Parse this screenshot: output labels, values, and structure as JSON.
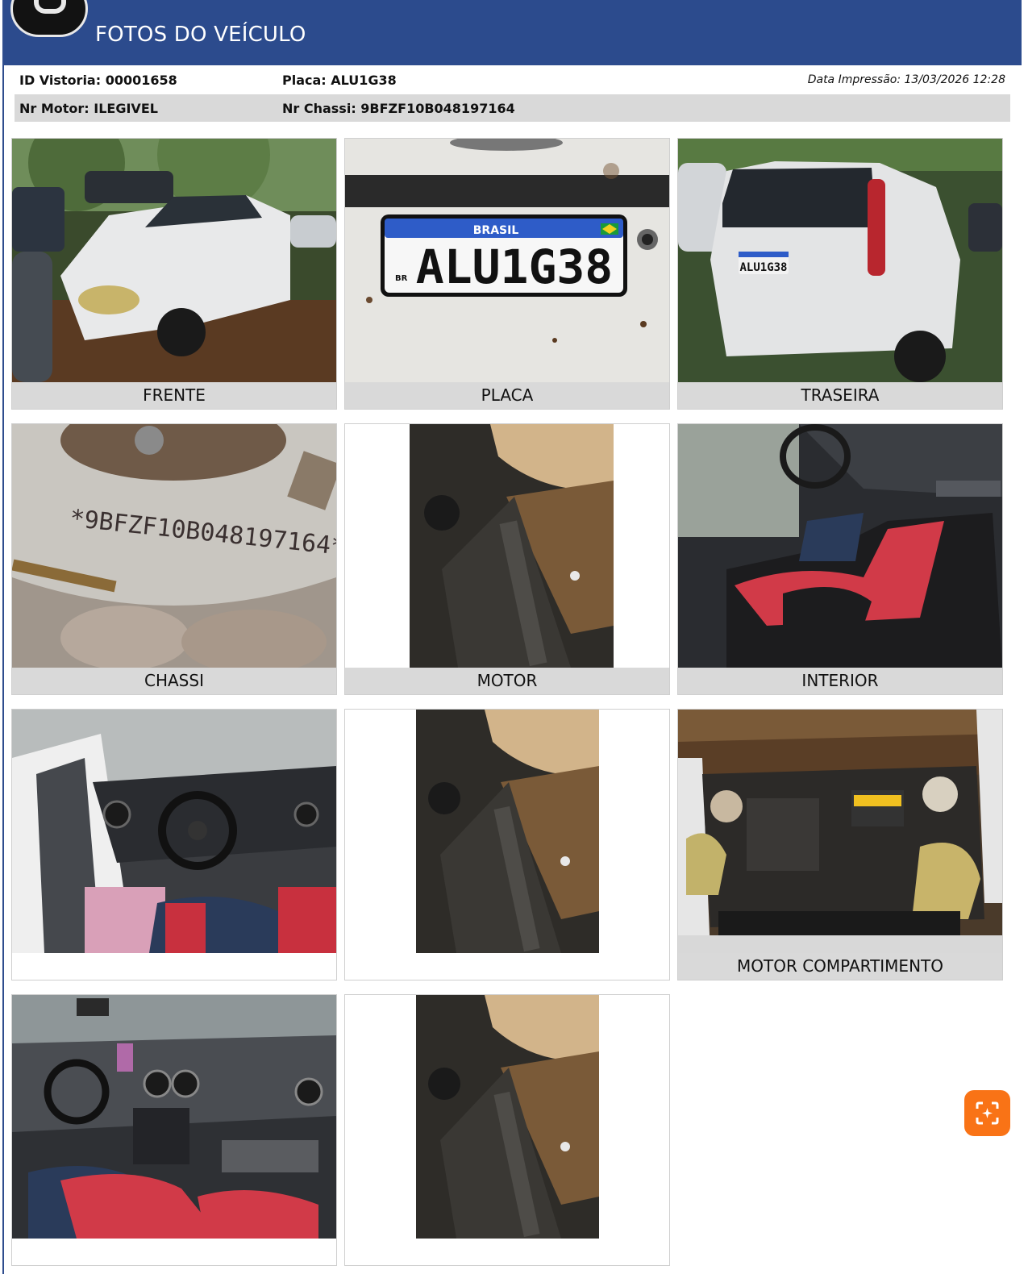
{
  "header": {
    "title": "FOTOS DO VEÍCULO",
    "logo_icon": "camera-icon"
  },
  "info": {
    "id_vistoria": "ID Vistoria: 00001658",
    "placa": "Placa: ALU1G38",
    "data_impressao": "Data Impressão: 13/03/2026 12:28",
    "nr_motor": "Nr Motor: ILEGIVEL",
    "nr_chassi": "Nr Chassi: 9BFZF10B048197164"
  },
  "photos": [
    {
      "caption": "FRENTE"
    },
    {
      "caption": "PLACA"
    },
    {
      "caption": "TRASEIRA"
    },
    {
      "caption": "CHASSI"
    },
    {
      "caption": "MOTOR"
    },
    {
      "caption": "INTERIOR"
    },
    {
      "caption": ""
    },
    {
      "caption": ""
    },
    {
      "caption": "MOTOR COMPARTIMENTO"
    },
    {
      "caption": ""
    },
    {
      "caption": ""
    }
  ],
  "plate": {
    "country": "BRASIL",
    "number": "ALU1G38",
    "code": "BR"
  },
  "chassis_stamp": "*9BFZF10B048197164*",
  "colors": {
    "header": "#2c4b8d",
    "caption_bg": "#d9d9d9",
    "fab": "#f97316"
  },
  "fab": {
    "icon": "ai-scan-icon"
  }
}
